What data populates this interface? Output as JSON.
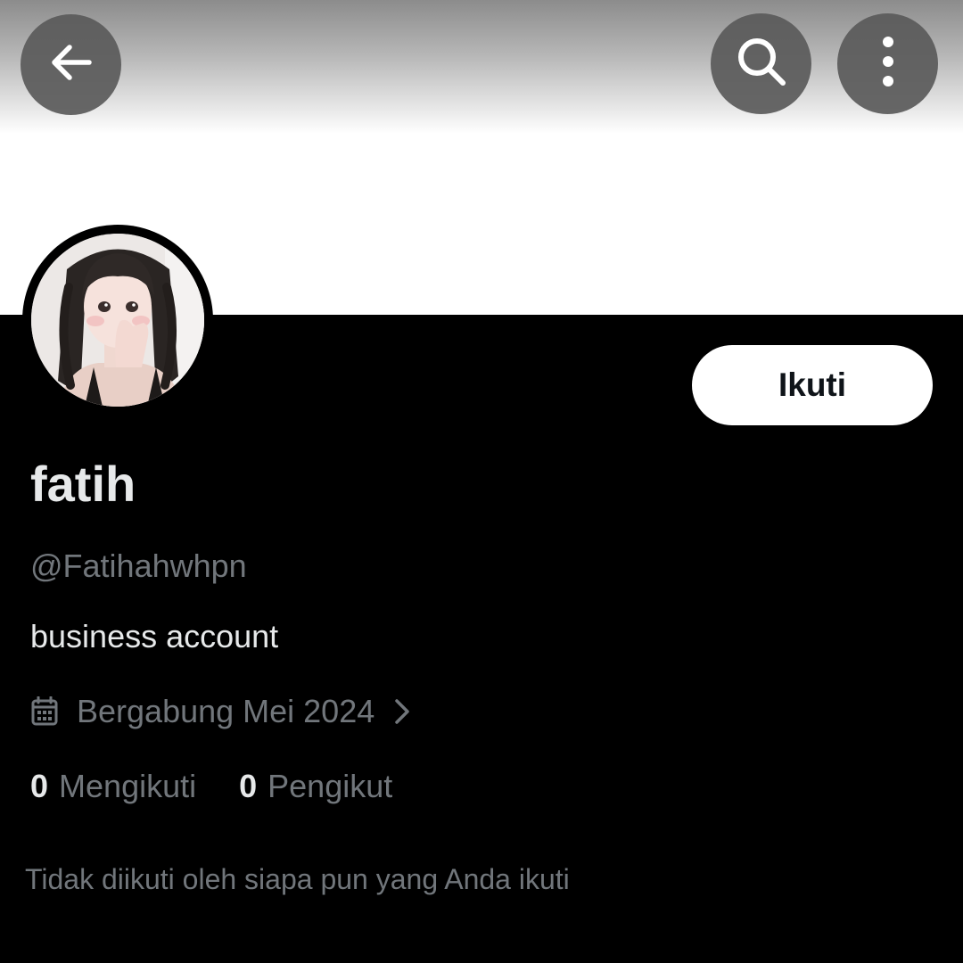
{
  "header": {
    "back_icon": "arrow-left-icon",
    "search_icon": "search-icon",
    "more_icon": "more-vertical-icon"
  },
  "banner": {
    "color": "#ffffff"
  },
  "profile": {
    "avatar_icon": "avatar-photo",
    "display_name": "fatih",
    "handle": "@Fatihahwhpn",
    "bio": "business account",
    "joined_icon": "calendar-icon",
    "joined_text": "Bergabung Mei 2024",
    "joined_chevron_icon": "chevron-right-icon"
  },
  "actions": {
    "follow_label": "Ikuti"
  },
  "stats": {
    "following_count": "0",
    "following_label": "Mengikuti",
    "followers_count": "0",
    "followers_label": "Pengikut"
  },
  "followed_by_note": "Tidak diikuti oleh siapa pun yang Anda ikuti",
  "colors": {
    "background": "#000000",
    "primary_text": "#e7e9ea",
    "secondary_text": "#71767b",
    "button_bg": "#ffffff",
    "button_text": "#0f1419"
  }
}
